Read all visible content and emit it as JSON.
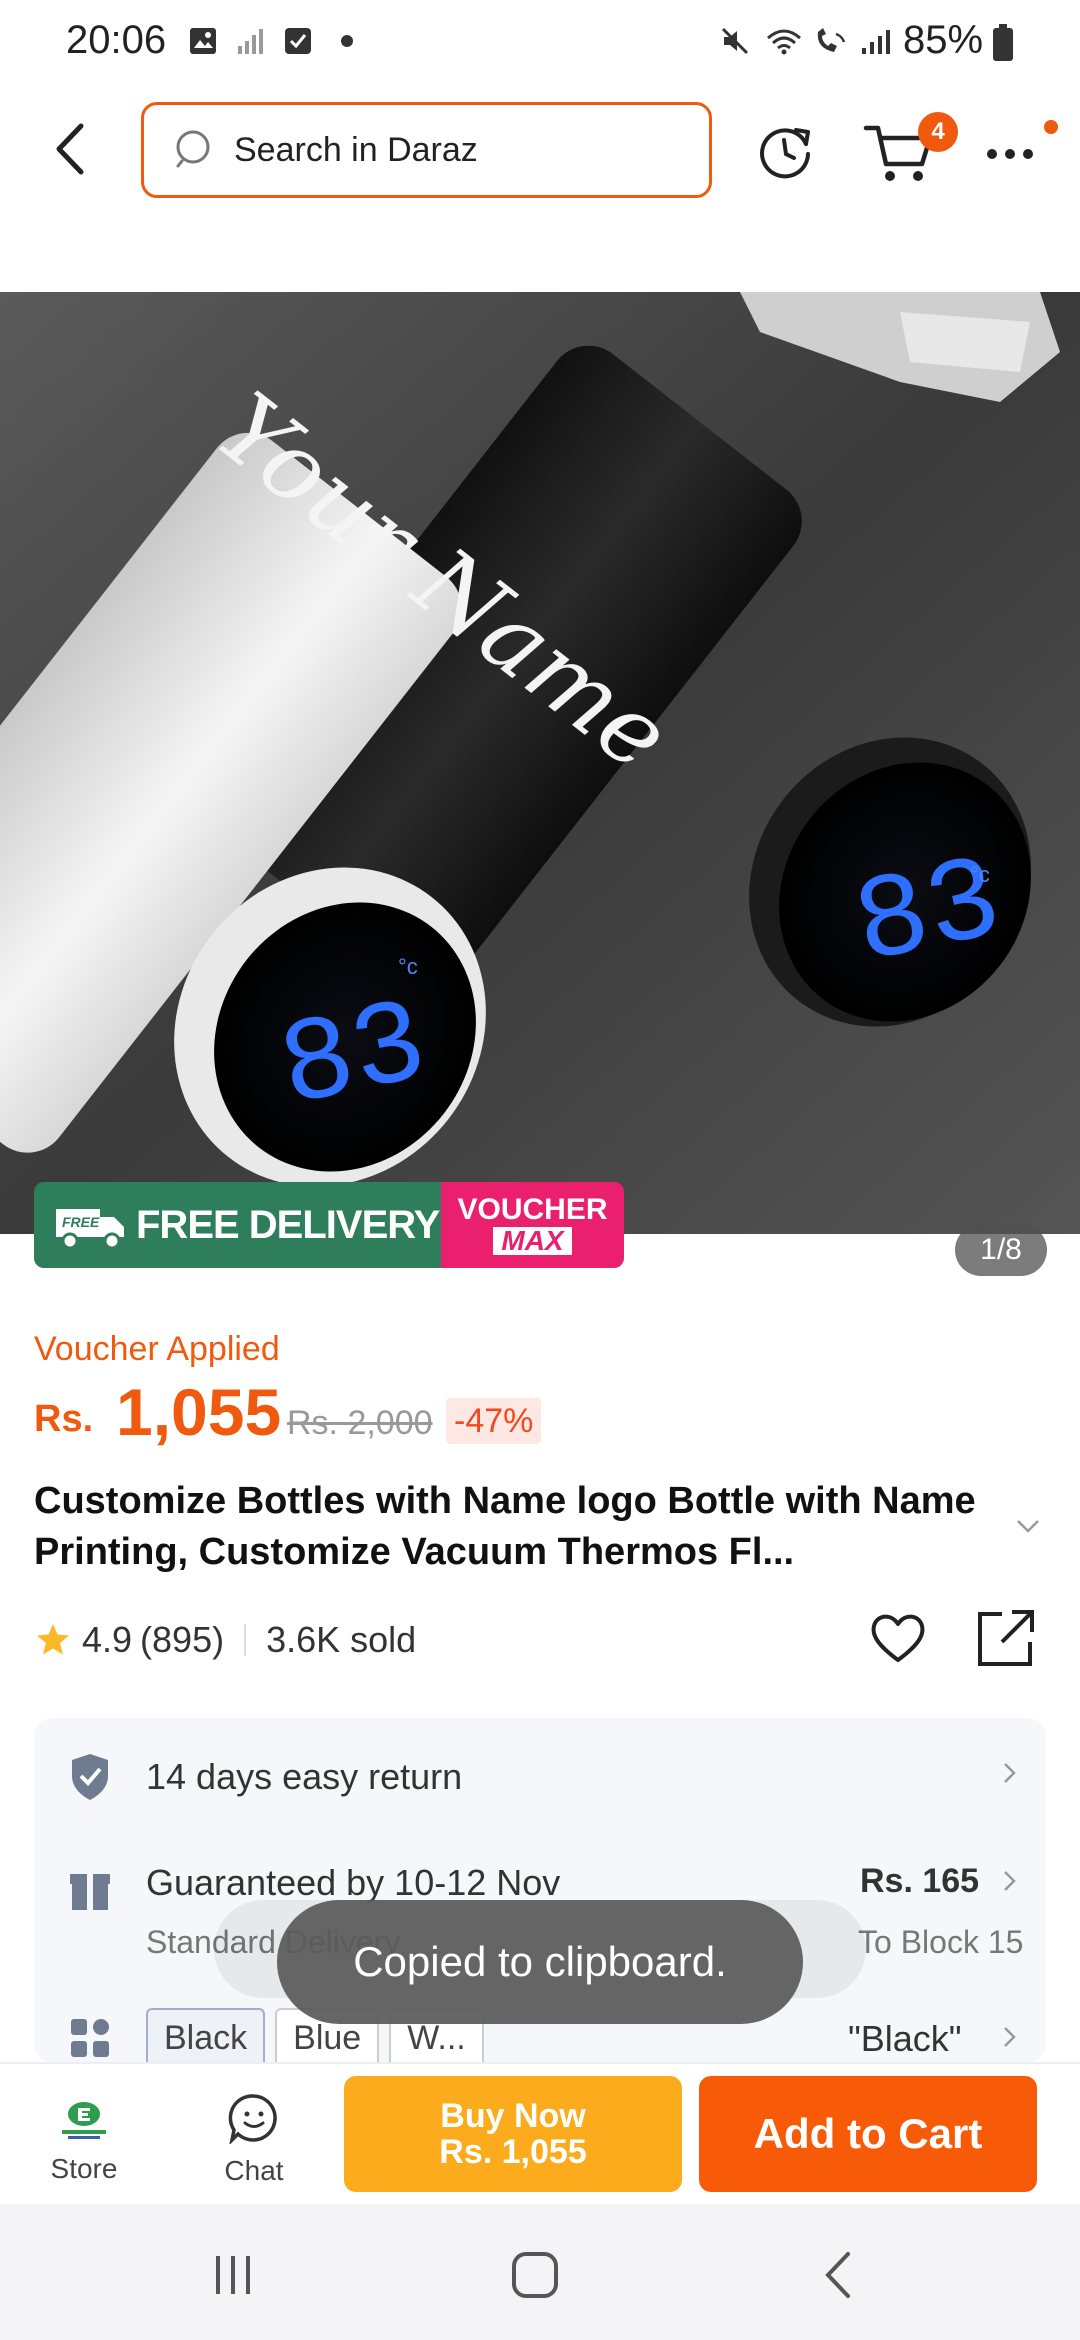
{
  "status_bar": {
    "time": "20:06",
    "battery": "85%"
  },
  "header": {
    "search_placeholder": "Search in Daraz",
    "cart_count": "4"
  },
  "product_image": {
    "engraved_text": "Your Name",
    "display_reading": "83",
    "display_unit": "°c",
    "counter": "1/8",
    "badges": {
      "free_delivery": "FREE DELIVERY",
      "free_tag": "FREE",
      "voucher_line1": "VOUCHER",
      "voucher_line2": "MAX"
    }
  },
  "price": {
    "voucher_applied": "Voucher Applied",
    "currency": "Rs.",
    "current": "1,055",
    "original": "Rs. 2,000",
    "discount": "-47%"
  },
  "product": {
    "title": "Customize Bottles with Name logo Bottle with Name Printing, Customize Vacuum Thermos Fl...",
    "rating": "4.9",
    "reviews": "(895)",
    "sold": "3.6K sold"
  },
  "info": {
    "return_label": "14 days easy return",
    "delivery_label": "Guaranteed by 10-12 Nov",
    "delivery_sub": "Standard Delivery",
    "delivery_price": "Rs. 165",
    "delivery_location": "To Block 15",
    "colors": [
      "Black",
      "Blue",
      "W..."
    ],
    "selected_color": "\"Black\""
  },
  "toast": {
    "message": "Copied to clipboard."
  },
  "bottom_bar": {
    "store_label": "Store",
    "chat_label": "Chat",
    "buy_now_label": "Buy Now",
    "buy_now_price": "Rs. 1,055",
    "add_to_cart_label": "Add to Cart"
  },
  "colors": {
    "accent": "#f05a0e",
    "buy_now": "#fcab1c",
    "add_to_cart": "#f85b07",
    "free_delivery": "#2e7d5b",
    "voucher_max": "#ea1f6e"
  }
}
